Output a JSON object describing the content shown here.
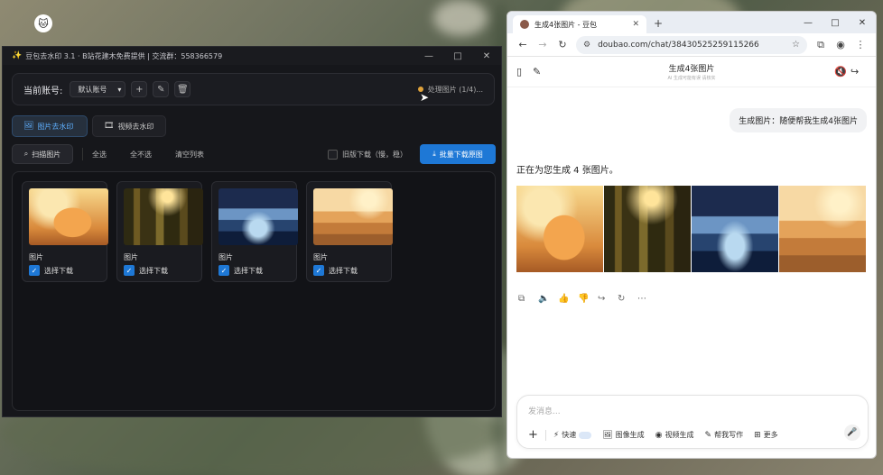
{
  "desktop": {
    "icon": "cat-icon"
  },
  "app": {
    "title": "豆包去水印 3.1 · B站花建木免费提供 | 交流群：558366579",
    "window_controls": [
      "—",
      "□",
      "✕"
    ],
    "account_label": "当前账号:",
    "account_value": "默认账号",
    "status_text": "处理图片 (1/4)...",
    "tabs": [
      {
        "label": "图片去水印",
        "icon": "image-icon"
      },
      {
        "label": "视频去水印",
        "icon": "video-icon"
      }
    ],
    "scan_label": "扫描图片",
    "select_all": "全选",
    "select_none": "全不选",
    "clear_list": "清空列表",
    "old_download_label": "旧版下载（慢，稳）",
    "batch_download_label": "批量下载原图",
    "cards": [
      {
        "label": "图片",
        "select": "选择下载",
        "img": "img-cat"
      },
      {
        "label": "图片",
        "select": "选择下载",
        "img": "img-forest"
      },
      {
        "label": "图片",
        "select": "选择下载",
        "img": "img-city"
      },
      {
        "label": "图片",
        "select": "选择下载",
        "img": "img-beach"
      }
    ]
  },
  "browser": {
    "tab_title": "生成4张图片 - 豆包",
    "url": "doubao.com/chat/38430525259115266",
    "chat_title": "生成4张图片",
    "chat_subtitle": "AI 生成可能有误 请核实",
    "user_message": "生成图片：随便帮我生成4张图片",
    "bot_message": "正在为您生成 4 张图片。",
    "composer_placeholder": "发消息...",
    "tools": [
      {
        "label": "快速",
        "icon": "lightning-icon"
      },
      {
        "label": "图像生成",
        "icon": "image-icon"
      },
      {
        "label": "视频生成",
        "icon": "video-icon"
      },
      {
        "label": "帮我写作",
        "icon": "pen-icon"
      },
      {
        "label": "更多",
        "icon": "grid-icon"
      }
    ]
  }
}
